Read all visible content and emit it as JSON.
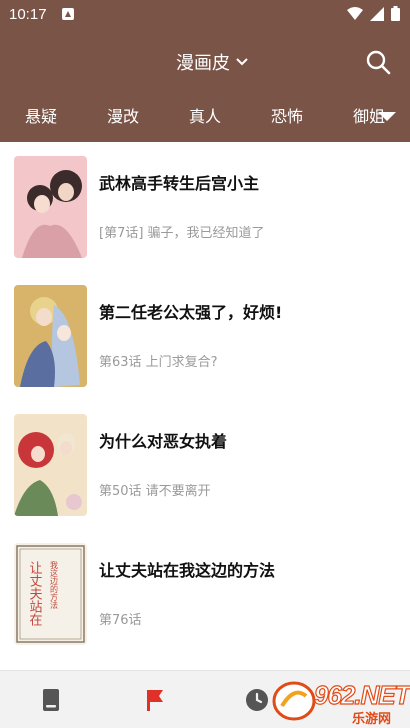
{
  "status_bar": {
    "time": "10:17"
  },
  "header": {
    "app_title": "漫画皮"
  },
  "tabs": [
    {
      "label": "悬疑"
    },
    {
      "label": "漫改"
    },
    {
      "label": "真人"
    },
    {
      "label": "恐怖"
    },
    {
      "label": "御姐"
    }
  ],
  "comics": [
    {
      "title": "武林高手转生后宫小主",
      "chapter": "[第7话] 骗子，我已经知道了",
      "cover_colors": [
        "#f3c6c9",
        "#3b2b2a",
        "#d9a0a8"
      ]
    },
    {
      "title": "第二任老公太强了，好烦!",
      "chapter": "第63话 上门求复合?",
      "cover_colors": [
        "#d8b36a",
        "#b5c6e0",
        "#5a6fa0"
      ]
    },
    {
      "title": "为什么对恶女执着",
      "chapter": "第50话 请不要离开",
      "cover_colors": [
        "#f2e3c8",
        "#c9363a",
        "#6a8a5a"
      ]
    },
    {
      "title": "让丈夫站在我这边的方法",
      "chapter": "第76话",
      "cover_title": "让丈夫站在",
      "cover_subtitle": "我这边的方法",
      "cover_colors": [
        "#f5f1e8",
        "#c2473d",
        "#8a7a62"
      ]
    }
  ],
  "watermark": {
    "text": "962.NET",
    "subtext": "乐游网"
  }
}
